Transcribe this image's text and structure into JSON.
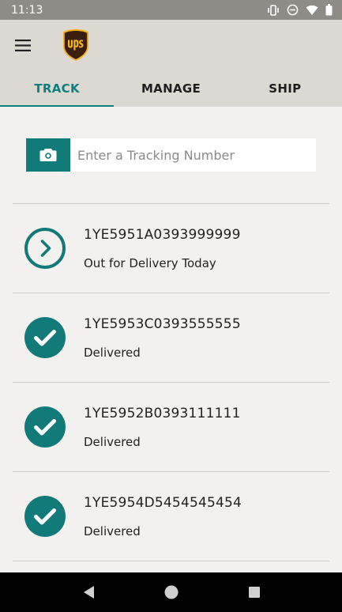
{
  "status_bar": {
    "time": "11:13",
    "icons": [
      "vibrate-icon",
      "do-not-disturb-icon",
      "wifi-icon",
      "battery-icon"
    ]
  },
  "app_bar": {
    "menu_icon": "menu-icon",
    "logo": "ups-logo"
  },
  "tabs": [
    {
      "label": "TRACK",
      "active": true
    },
    {
      "label": "MANAGE",
      "active": false
    },
    {
      "label": "SHIP",
      "active": false
    }
  ],
  "search": {
    "camera_icon": "camera-icon",
    "placeholder": "Enter a Tracking Number",
    "value": ""
  },
  "packages": [
    {
      "tracking_number": "1YE5951A0393999999",
      "status": "Out for Delivery Today",
      "icon": "chevron-circle-icon"
    },
    {
      "tracking_number": "1YE5953C0393555555",
      "status": "Delivered",
      "icon": "check-circle-icon"
    },
    {
      "tracking_number": "1YE5952B0393111111",
      "status": "Delivered",
      "icon": "check-circle-icon"
    },
    {
      "tracking_number": "1YE5954D5454545454",
      "status": "Delivered",
      "icon": "check-circle-icon"
    }
  ],
  "nav_bar": {
    "icons": [
      "back-icon",
      "home-icon",
      "recents-icon"
    ]
  },
  "colors": {
    "accent": "#127a78",
    "header": "#dcd8d2",
    "background": "#f2f1ef",
    "ups_brown": "#3b1f0e",
    "ups_gold": "#f5b21b"
  }
}
